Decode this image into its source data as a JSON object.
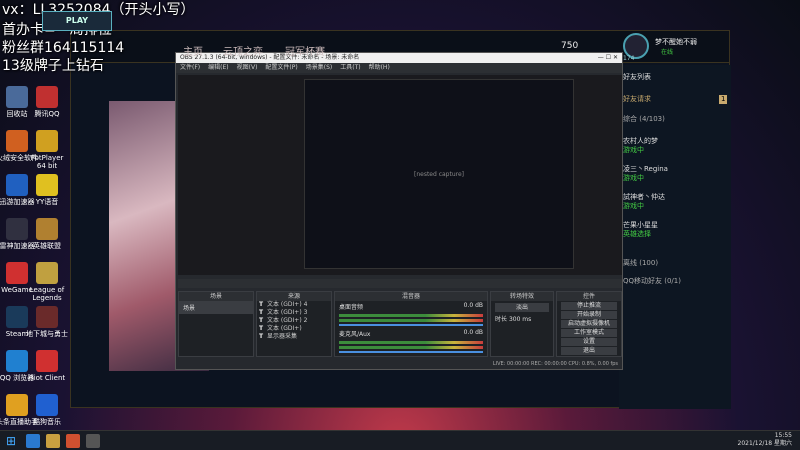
{
  "overlay": {
    "line1": "vx：LL3252084（开头小写）",
    "line2": "首办卡=一局排位",
    "line3": "粉丝群164115114",
    "line4": "13级牌子上钻石"
  },
  "desktop": [
    {
      "label": "回收站",
      "color": "#4a6a9a"
    },
    {
      "label": "腾讯QQ",
      "color": "#c03030"
    },
    {
      "label": "火绒安全软件",
      "color": "#d06020"
    },
    {
      "label": "PotPlayer 64 bit",
      "color": "#d0a020"
    },
    {
      "label": "迅游加速器",
      "color": "#2060c0"
    },
    {
      "label": "YY语音",
      "color": "#e0c020"
    },
    {
      "label": "雷神加速器",
      "color": "#303040"
    },
    {
      "label": "英雄联盟",
      "color": "#b08030"
    },
    {
      "label": "WeGame",
      "color": "#d03030"
    },
    {
      "label": "League of Legends",
      "color": "#c0a040"
    },
    {
      "label": "Steam",
      "color": "#1a3a5a"
    },
    {
      "label": "地下城与勇士",
      "color": "#6a2a2a"
    },
    {
      "label": "QQ 浏览器",
      "color": "#2080d0"
    },
    {
      "label": "Riot Client",
      "color": "#d03030"
    },
    {
      "label": "头条直播助手",
      "color": "#e0a020"
    },
    {
      "label": "酷狗音乐",
      "color": "#2060d0"
    }
  ],
  "lol": {
    "play": "PLAY",
    "tabs": [
      "主页",
      "云顶之弈",
      "冠军杯赛"
    ],
    "currency": "750",
    "username": "梦不醒她不弱",
    "status": "在线",
    "level": "174",
    "friends": {
      "header": "好友列表",
      "requests": "好友请求",
      "req_count": "1",
      "group": "综合 (4/103)",
      "list": [
        {
          "name": "农村人的梦",
          "status": "游戏中"
        },
        {
          "name": "凌三丶Regina",
          "status": "游戏中"
        },
        {
          "name": "試神者丶仲达",
          "status": "游戏中"
        },
        {
          "name": "芒果小星星",
          "status": "英雄选择"
        }
      ],
      "offline": "离线 (100)",
      "mobile": "QQ移动好友 (0/1)"
    }
  },
  "obs": {
    "title": "OBS 27.1.3 (64-bit, windows) - 配置文件: 未命名 - 场景: 未命名",
    "menu": [
      "文件(F)",
      "编辑(E)",
      "视图(V)",
      "配置文件(P)",
      "场景集(S)",
      "工具(T)",
      "帮助(H)"
    ],
    "panels": {
      "scenes": "场景",
      "sources": "来源",
      "mixer": "混音器",
      "transitions": "转场特效",
      "controls": "控件"
    },
    "scene_item": "场景",
    "sources": [
      "文本 (GDI+) 4",
      "文本 (GDI+) 3",
      "文本 (GDI+) 2",
      "文本 (GDI+)",
      "显示器采集"
    ],
    "mixer": [
      {
        "name": "桌面音频",
        "db": "0.0 dB"
      },
      {
        "name": "麦克风/Aux",
        "db": "0.0 dB"
      }
    ],
    "transition": "淡出",
    "duration_label": "时长",
    "duration": "300 ms",
    "buttons": [
      "停止推流",
      "开始录制",
      "启动虚拟摄像机",
      "工作室模式",
      "设置",
      "退出"
    ],
    "status": "LIVE: 00:00:00   REC: 00:00:00   CPU: 0.8%, 0.00 fps"
  },
  "taskbar": {
    "time": "15:55",
    "date": "2021/12/18 星期六"
  }
}
